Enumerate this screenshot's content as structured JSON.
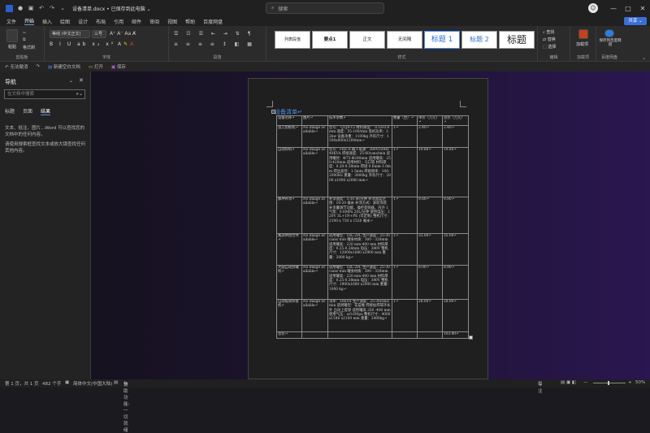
{
  "titlebar": {
    "doc_title": "设备清单.docx • 已保存到此电脑 ⌄",
    "search_placeholder": "搜索",
    "avatar_letter": "☺"
  },
  "menu": [
    "文件",
    "开始",
    "插入",
    "绘图",
    "设计",
    "布局",
    "引用",
    "邮件",
    "审阅",
    "视图",
    "帮助",
    "百度网盘"
  ],
  "share_label": "共享 ⌄",
  "ribbon": {
    "clipboard": {
      "paste": "粘贴",
      "format_painter": "格式刷",
      "label": "剪贴板"
    },
    "font": {
      "name": "等线 (中文正文)",
      "size": "三号",
      "label": "字体"
    },
    "paragraph": {
      "label": "段落"
    },
    "styles": {
      "items": [
        "列表段落",
        "要点1",
        "正文",
        "无间隔",
        "标题 1",
        "标题 2",
        "标题"
      ],
      "label": "样式"
    },
    "editing": {
      "find": "查找",
      "replace": "替换",
      "select": "选择",
      "label": "编辑"
    },
    "addins": {
      "label": "加载项",
      "btn": "加载项"
    },
    "baidu": {
      "label": "百度网盘",
      "btn1": "保存到百度网盘"
    }
  },
  "qabar": {
    "items": [
      "↶ 无法撤消",
      "↷",
      "新建空白文档",
      "打开",
      "保存"
    ]
  },
  "nav": {
    "title": "导航",
    "search_placeholder": "在文档中搜索",
    "tabs": [
      "标题",
      "页面",
      "结果"
    ],
    "text1": "文本、批注、图片...Word 可以查找您的文档中的任何内容。",
    "text2": "请使用搜索框查找文本或放大镜查找任何其他内容。"
  },
  "doc": {
    "heading": "设备清单↵",
    "headers": [
      "设备名称↵",
      "图片↵",
      "技术参数↵",
      "数量（台）↵",
      "单价（万元）↵",
      "总价（万元）↵"
    ],
    "rows": [
      [
        "溢刀剪板机↵",
        "No image available↵",
        "型号： QTJ8-15 材料厚度： 0.18-0.4mm 速度：55-100/min 电机功率：2.2kw 设备净重：1100kg 外形尺寸：1500x800x1200mm↵",
        "1↵",
        "2.40↵",
        "2.40↵"
      ],
      [
        "自动焊机↵",
        "No image available↵",
        "型号：FBZ-A 输入电源：380V/50Hz 40KVA 焊接速度：25-60cans/min 适用罐径：Φ75-Φ290mm 适用罐高：250-420mm 适用材料：马口铁 材料厚度：0.28-0.38mm 焊接 0.6mm-1.0mm 焊丝直径：1.5mm 焊接频率：100-2000Hz 重量：3000kg 外形尺寸：2800 x1900 x2000 mm↵",
        "1↵",
        "19.80↵",
        "19.80↵"
      ],
      [
        "脉冲补涂↵",
        "No image available↵",
        "补涂速度：5-30 米/分钟 补涂宽度范围：10-20 毫米 补涂方式：滚轮涂装 补涂量调节功能，操控变频器，内外 1 气泵：0.6MPa 20L/分钟 使用电压：220V 3L+1N+PE (可定制) 整机尺寸：2100 x 720 x 1520 毫米↵",
        "1↵",
        "9.80↵",
        "9.80↵"
      ],
      [
        "尾部烘组合件↵",
        "No image available↵",
        "适用罐型：18L-20L 生产速度：25-30cans/ min 罐身材质：300 - 320mm 适用罐高：220 mm-400 mm 材料厚度：0.25-0.38mm 电压：380V 整机尺寸：12000x1680 x2900 mm 重量：3000 kg↵",
        "1↵",
        "35.00↵",
        "35.00↵"
      ],
      [
        "大圆自动封罐机↵",
        "No image available↵",
        "适用罐型：18L-20L 生产速度：25-30cans/ min 罐身材质：300 - 320mm 适用罐高：220 mm-400 mm 材料厚度：0.25-0.38mm 电压：380V 整机尺寸：1900x1680 x2900 mm 重量：1000 kg↵",
        "1↵",
        "8.90↵",
        "8.90↵"
      ],
      [
        "自动提梁焊接机↵",
        "No image available↵",
        "功率：50KVA 生产速度：25-30cans/ min 适用罐型：花篮桶 焊接加焊耳环长外 自动上提梁 适用罐高 250 -400 mm 使用气压：≥0.6Mpa 整机尺寸：4000 x1540 x2100 mm 重量：2400kg↵",
        "1↵",
        "28.00↵",
        "28.00↵"
      ]
    ],
    "total_label": "总价↵",
    "total_value": "103.90↵"
  },
  "status": {
    "page": "第 1 页，共 1 页",
    "words": "482 个字",
    "lang": "简体中文(中国大陆)",
    "accessibility": "辅助功能: 一切就绪",
    "focus": "专注",
    "zoom": "50%"
  }
}
